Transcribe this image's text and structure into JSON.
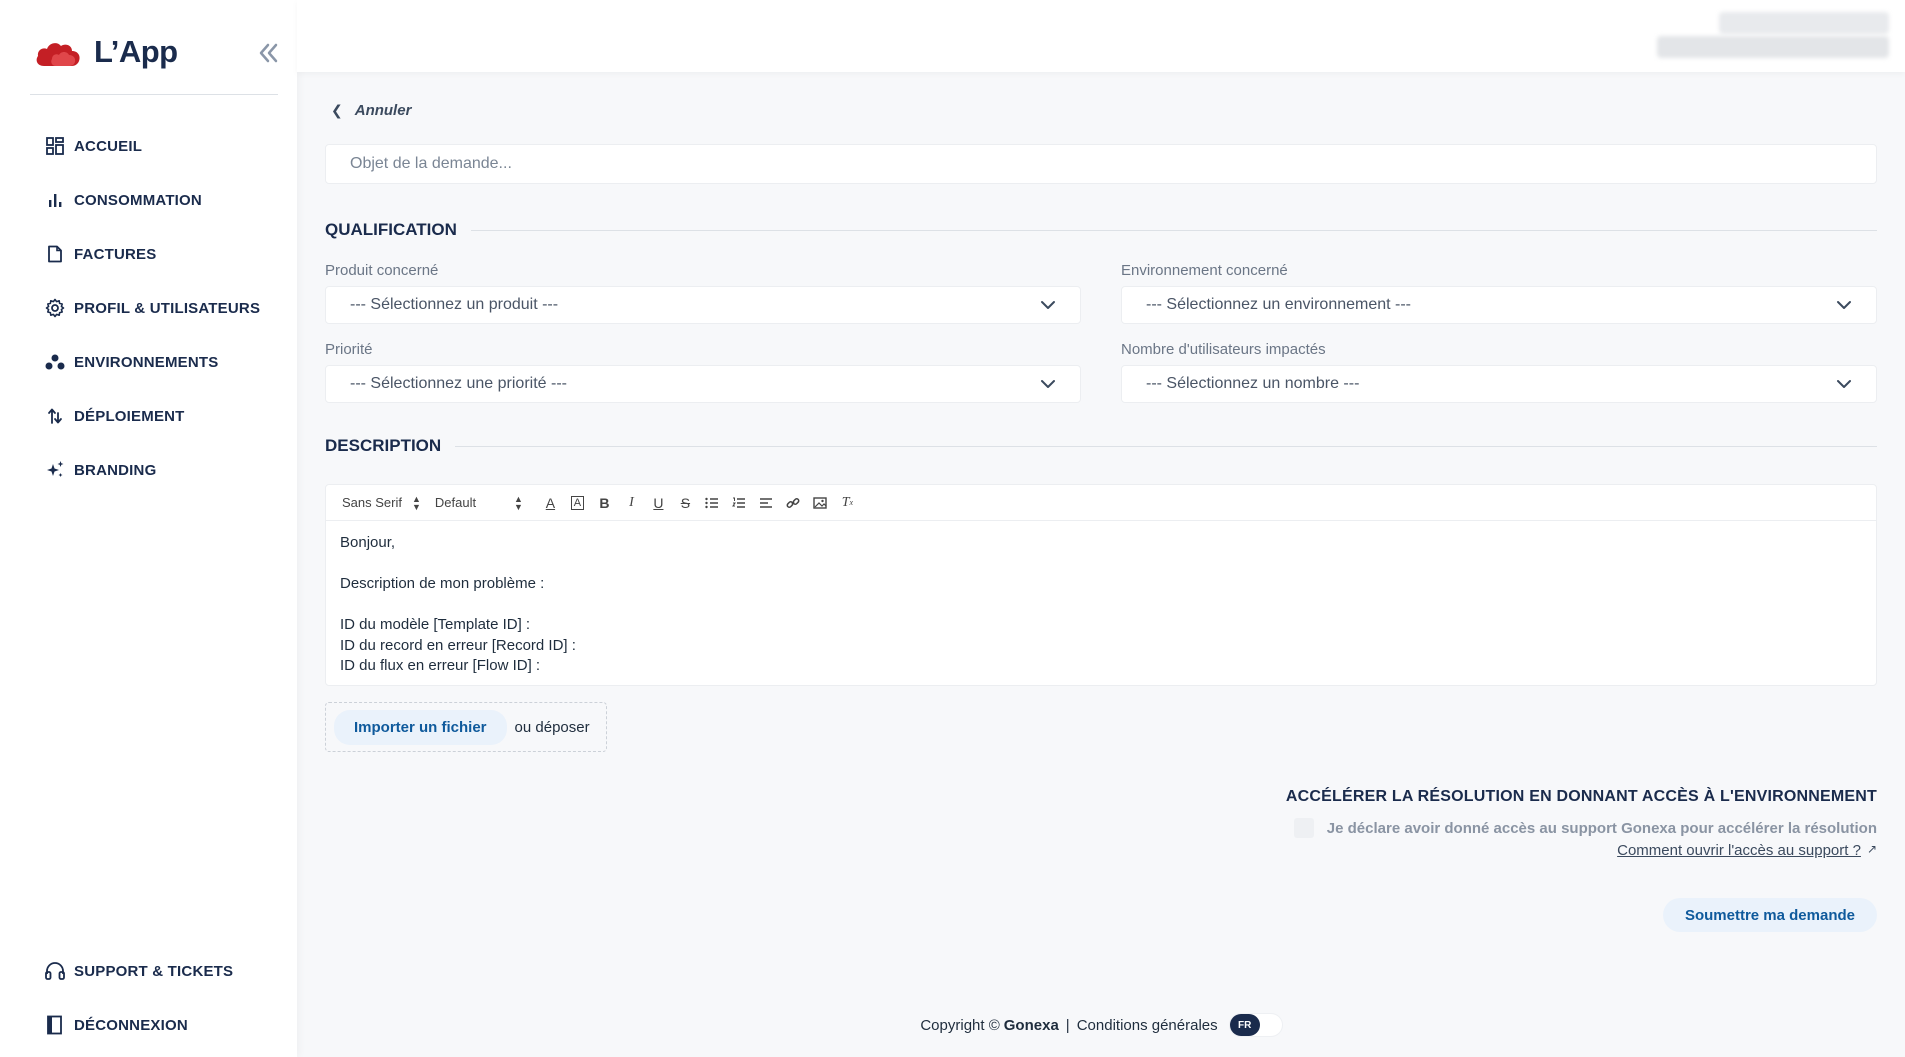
{
  "app": {
    "name": "L’App"
  },
  "sidebar": {
    "items": [
      {
        "label": "ACCUEIL",
        "icon": "dashboard-icon"
      },
      {
        "label": "CONSOMMATION",
        "icon": "bar-chart-icon"
      },
      {
        "label": "FACTURES",
        "icon": "document-icon"
      },
      {
        "label": "PROFIL & UTILISATEURS",
        "icon": "gear-icon"
      },
      {
        "label": "ENVIRONNEMENTS",
        "icon": "cluster-icon"
      },
      {
        "label": "DÉPLOIEMENT",
        "icon": "deploy-arrows-icon"
      },
      {
        "label": "BRANDING",
        "icon": "sparkles-icon"
      }
    ],
    "bottom_items": [
      {
        "label": "SUPPORT & TICKETS",
        "icon": "headset-icon"
      },
      {
        "label": "DÉCONNEXION",
        "icon": "logout-icon"
      }
    ]
  },
  "form": {
    "back_label": "Annuler",
    "subject_placeholder": "Objet de la demande...",
    "qualification_title": "QUALIFICATION",
    "product_label": "Produit concerné",
    "product_value": "--- Sélectionnez un produit ---",
    "environment_label": "Environnement concerné",
    "environment_value": "--- Sélectionnez un environnement ---",
    "priority_label": "Priorité",
    "priority_value": "--- Sélectionnez une priorité ---",
    "users_label": "Nombre d'utilisateurs impactés",
    "users_value": "--- Sélectionnez un nombre ---",
    "description_title": "DESCRIPTION",
    "editor": {
      "font_family": "Sans Serif",
      "font_size": "Default",
      "lines": [
        "Bonjour,",
        "",
        "Description de mon problème :",
        "",
        "ID du modèle [Template ID] :",
        "ID du record en erreur [Record ID] :",
        "ID du flux en erreur [Flow ID] :"
      ]
    },
    "upload_button": "Importer un fichier",
    "upload_or": "ou déposer",
    "access_title": "ACCÉLÉRER LA RÉSOLUTION EN DONNANT ACCÈS À L'ENVIRONNEMENT",
    "access_checkbox_label": "Je déclare avoir donné accès au support Gonexa pour accélérer la résolution",
    "access_checked": false,
    "access_link": "Comment ouvrir l'accès au support ?",
    "submit_label": "Soumettre ma demande"
  },
  "footer": {
    "copyright": "Copyright ©",
    "company": "Gonexa",
    "separator": "|",
    "terms": "Conditions générales",
    "language": "FR"
  },
  "colors": {
    "brand_red": "#d7262b",
    "navy": "#1a2b4c",
    "link_blue": "#0f5a9c",
    "button_bg": "#eaf2fb"
  }
}
